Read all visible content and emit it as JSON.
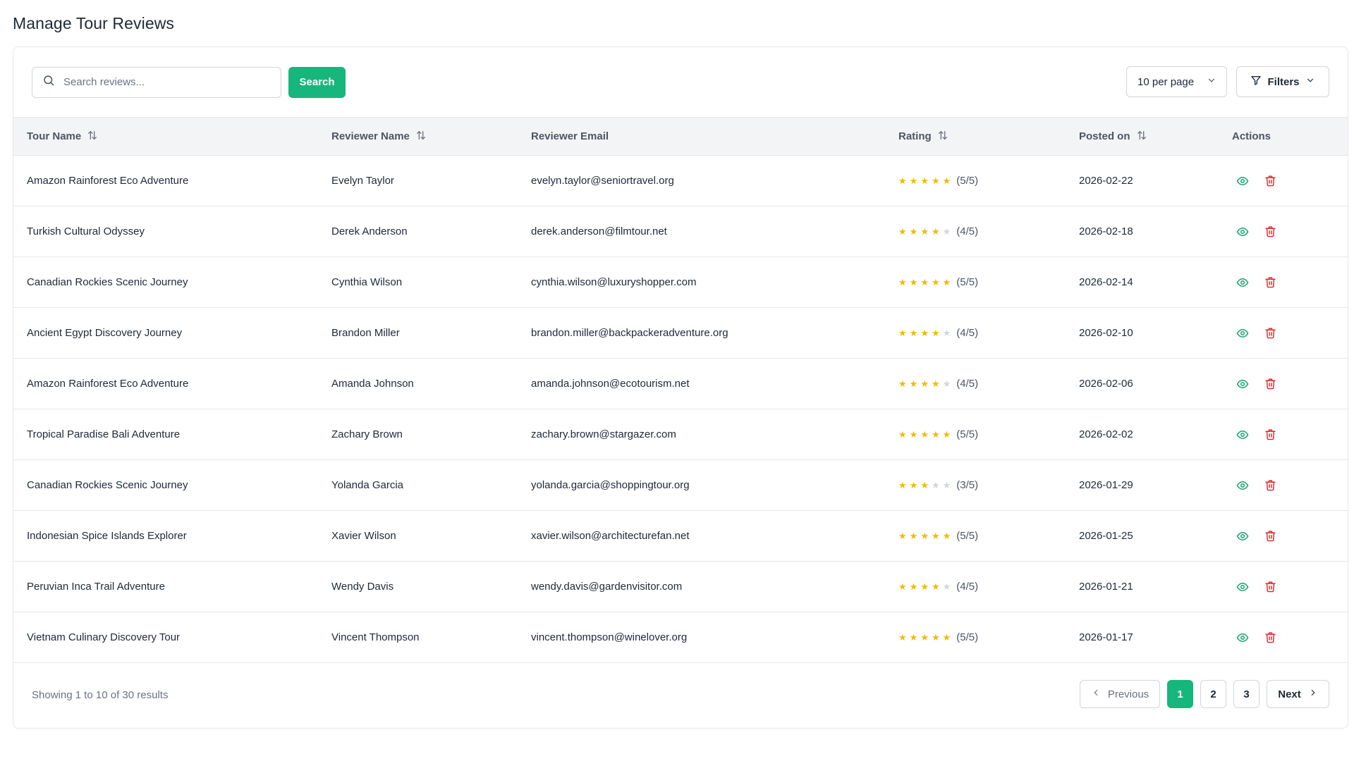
{
  "page": {
    "title": "Manage Tour Reviews"
  },
  "toolbar": {
    "search_placeholder": "Search reviews...",
    "search_button": "Search",
    "per_page": "10 per page",
    "filters": "Filters"
  },
  "table": {
    "headers": {
      "tour_name": "Tour Name",
      "reviewer_name": "Reviewer Name",
      "reviewer_email": "Reviewer Email",
      "rating": "Rating",
      "posted_on": "Posted on",
      "actions": "Actions"
    },
    "rows": [
      {
        "tour": "Amazon Rainforest Eco Adventure",
        "reviewer": "Evelyn Taylor",
        "email": "evelyn.taylor@seniortravel.org",
        "rating": 5,
        "rating_label": "(5/5)",
        "posted": "2026-02-22"
      },
      {
        "tour": "Turkish Cultural Odyssey",
        "reviewer": "Derek Anderson",
        "email": "derek.anderson@filmtour.net",
        "rating": 4,
        "rating_label": "(4/5)",
        "posted": "2026-02-18"
      },
      {
        "tour": "Canadian Rockies Scenic Journey",
        "reviewer": "Cynthia Wilson",
        "email": "cynthia.wilson@luxuryshopper.com",
        "rating": 5,
        "rating_label": "(5/5)",
        "posted": "2026-02-14"
      },
      {
        "tour": "Ancient Egypt Discovery Journey",
        "reviewer": "Brandon Miller",
        "email": "brandon.miller@backpackeradventure.org",
        "rating": 4,
        "rating_label": "(4/5)",
        "posted": "2026-02-10"
      },
      {
        "tour": "Amazon Rainforest Eco Adventure",
        "reviewer": "Amanda Johnson",
        "email": "amanda.johnson@ecotourism.net",
        "rating": 4,
        "rating_label": "(4/5)",
        "posted": "2026-02-06"
      },
      {
        "tour": "Tropical Paradise Bali Adventure",
        "reviewer": "Zachary Brown",
        "email": "zachary.brown@stargazer.com",
        "rating": 5,
        "rating_label": "(5/5)",
        "posted": "2026-02-02"
      },
      {
        "tour": "Canadian Rockies Scenic Journey",
        "reviewer": "Yolanda Garcia",
        "email": "yolanda.garcia@shoppingtour.org",
        "rating": 3,
        "rating_label": "(3/5)",
        "posted": "2026-01-29"
      },
      {
        "tour": "Indonesian Spice Islands Explorer",
        "reviewer": "Xavier Wilson",
        "email": "xavier.wilson@architecturefan.net",
        "rating": 5,
        "rating_label": "(5/5)",
        "posted": "2026-01-25"
      },
      {
        "tour": "Peruvian Inca Trail Adventure",
        "reviewer": "Wendy Davis",
        "email": "wendy.davis@gardenvisitor.com",
        "rating": 4,
        "rating_label": "(4/5)",
        "posted": "2026-01-21"
      },
      {
        "tour": "Vietnam Culinary Discovery Tour",
        "reviewer": "Vincent Thompson",
        "email": "vincent.thompson@winelover.org",
        "rating": 5,
        "rating_label": "(5/5)",
        "posted": "2026-01-17"
      }
    ]
  },
  "footer": {
    "showing": "Showing 1 to 10 of 30 results",
    "previous": "Previous",
    "next": "Next",
    "pages": [
      "1",
      "2",
      "3"
    ],
    "current_page": "1"
  },
  "colors": {
    "accent": "#16b67c",
    "star": "#f5b800",
    "star_empty": "#d1d5db",
    "view_icon": "#16a36f",
    "delete_icon": "#dc2626"
  },
  "icons": [
    "search-icon",
    "chevron-down-icon",
    "filter-icon",
    "sort-icon",
    "eye-icon",
    "trash-icon",
    "chevron-left-icon",
    "chevron-right-icon",
    "star-icon"
  ]
}
